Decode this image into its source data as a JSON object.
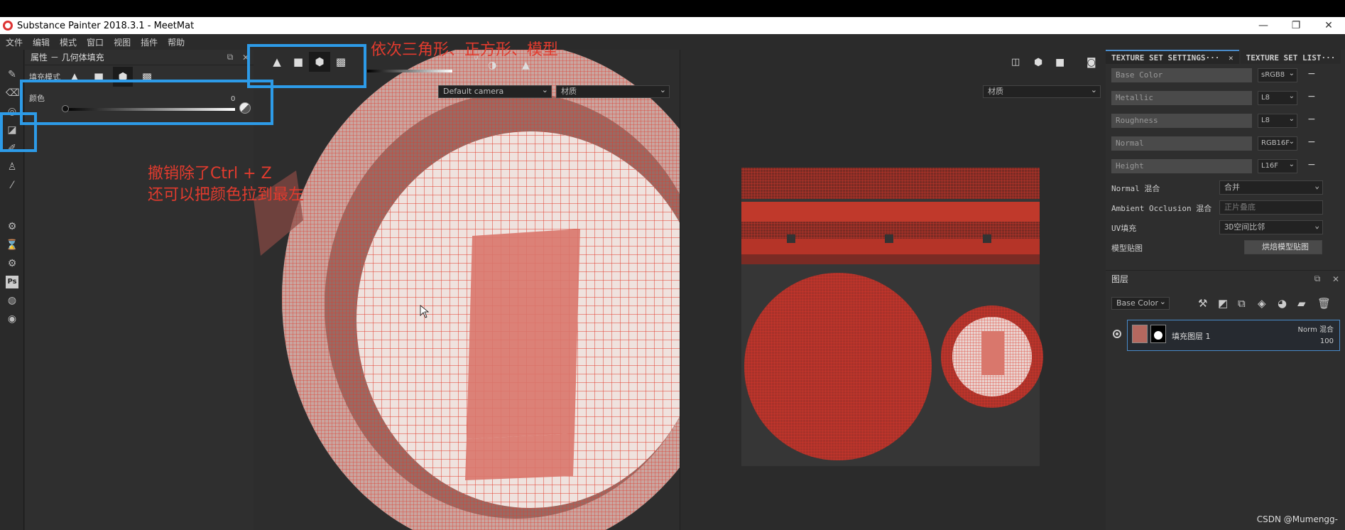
{
  "window": {
    "title": "Substance Painter 2018.3.1 - MeetMat",
    "controls": [
      "—",
      "❐",
      "✕"
    ]
  },
  "menu": [
    "文件",
    "编辑",
    "模式",
    "窗口",
    "视图",
    "插件",
    "帮助"
  ],
  "properties": {
    "title": "属性 － 几何体填充",
    "fill_mode_label": "填充模式",
    "color_label": "颜色",
    "color_value": "0"
  },
  "viewport": {
    "slider_value": "0",
    "camera_select": "Default camera",
    "material_select_left": "材质",
    "material_select_right": "材质"
  },
  "texture_set": {
    "tabs": [
      "TEXTURE SET SETTINGS···",
      "TEXTURE SET LIST···"
    ],
    "channels": [
      {
        "name": "Base Color",
        "format": "sRGB8"
      },
      {
        "name": "Metallic",
        "format": "L8"
      },
      {
        "name": "Roughness",
        "format": "L8"
      },
      {
        "name": "Normal",
        "format": "RGB16F"
      },
      {
        "name": "Height",
        "format": "L16F"
      }
    ],
    "options": [
      {
        "label": "Normal 混合",
        "value": "合并"
      },
      {
        "label": "Ambient Occlusion 混合",
        "value": "正片叠底"
      },
      {
        "label": "UV填充",
        "value": "3D空间比邻"
      },
      {
        "label": "模型贴图",
        "value": "烘焙模型贴图"
      }
    ]
  },
  "layers": {
    "title": "图层",
    "channel_select": "Base Color",
    "layer_name": "填充图层 1",
    "blend": "Norm 混合",
    "opacity": "100"
  },
  "annotations": {
    "modes": "依次三角形、正方形、模型",
    "undo_line1": "撤销除了Ctrl + Z",
    "undo_line2": "还可以把颜色拉到最左"
  },
  "watermark": "CSDN @Mumengg-",
  "colors": {
    "highlight": "#2d9be8",
    "annotation": "#e23b2e",
    "wireframe": "#e0392b"
  }
}
